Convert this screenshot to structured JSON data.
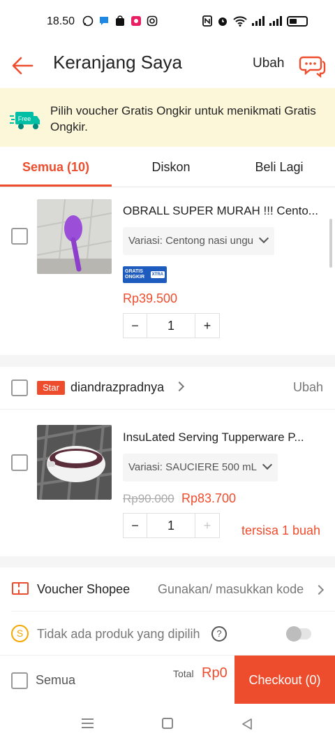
{
  "status_bar": {
    "time": "18.50",
    "left_icons": [
      "whatsapp-icon",
      "messenger-icon",
      "shop-icon",
      "app-icon",
      "instagram-icon"
    ],
    "right_icons": [
      "nfc-icon",
      "alarm-icon",
      "wifi-icon",
      "signal-icon",
      "signal-icon",
      "battery-icon"
    ]
  },
  "app_bar": {
    "title": "Keranjang Saya",
    "edit_label": "Ubah"
  },
  "banner": {
    "badge": "Free",
    "message": "Pilih voucher Gratis Ongkir untuk menikmati Gratis Ongkir."
  },
  "tabs": [
    {
      "label": "Semua (10)",
      "active": true
    },
    {
      "label": "Diskon",
      "active": false
    },
    {
      "label": "Beli Lagi",
      "active": false
    }
  ],
  "items": [
    {
      "name": "OBRALL SUPER MURAH !!! Cento...",
      "variant": "Variasi: Centong nasi ungu",
      "badge_line1": "GRATIS",
      "badge_line2": "ONGKIR",
      "badge_extra": "XTRA",
      "price": "Rp39.500",
      "quantity": "1",
      "minus": "−",
      "plus": "+"
    },
    {
      "name": "InsuLated Serving Tupperware P...",
      "variant": "Variasi: SAUCIERE 500 mL",
      "old_price": "Rp90.000",
      "price": "Rp83.700",
      "quantity": "1",
      "minus": "−",
      "plus": "+",
      "stock_note": "tersisa 1 buah"
    }
  ],
  "shop": {
    "badge": "Star",
    "name": "diandrazpradnya",
    "edit_label": "Ubah"
  },
  "voucher": {
    "label": "Voucher Shopee",
    "action": "Gunakan/ masukkan kode"
  },
  "coins": {
    "icon_text": "S",
    "label": "Tidak ada produk yang dipilih",
    "help": "?"
  },
  "checkout": {
    "select_all_label": "Semua",
    "total_label": "Total",
    "total_value": "Rp0",
    "button_label": "Checkout (0)"
  },
  "colors": {
    "accent": "#ee4d2d",
    "banner_bg": "#fdf7da",
    "freeship_blue": "#1e5bbf"
  }
}
